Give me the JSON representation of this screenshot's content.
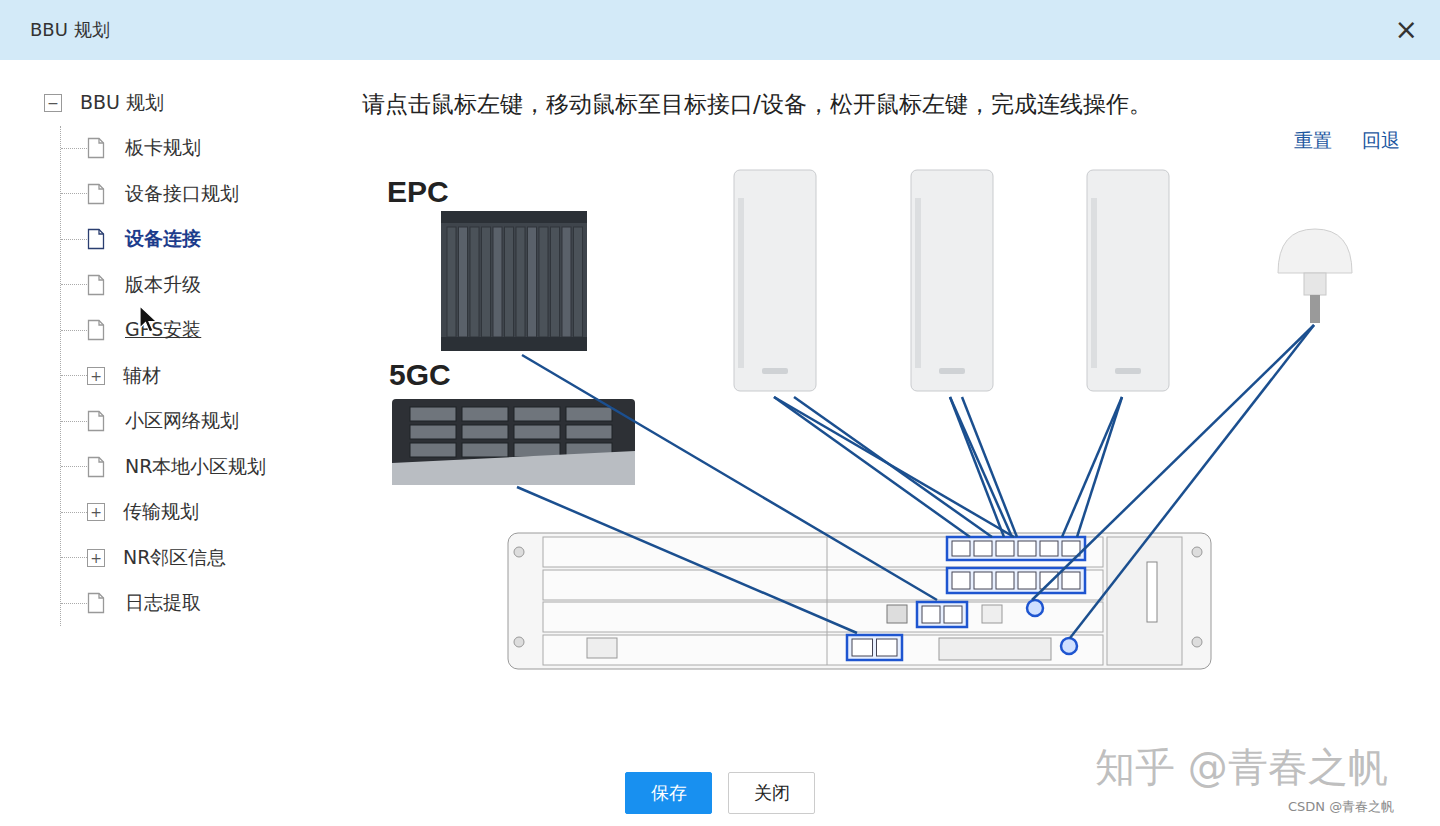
{
  "window": {
    "title": "BBU 规划",
    "close": "×"
  },
  "sidebar": {
    "root": {
      "label": "BBU 规划",
      "toggle": "−",
      "expanded": true,
      "children": [
        {
          "label": "板卡规划",
          "kind": "page",
          "selected": false,
          "hovered": false
        },
        {
          "label": "设备接口规划",
          "kind": "page",
          "selected": false,
          "hovered": false
        },
        {
          "label": "设备连接",
          "kind": "page",
          "selected": true,
          "hovered": false
        },
        {
          "label": "版本升级",
          "kind": "page",
          "selected": false,
          "hovered": false
        },
        {
          "label": "GPS安装",
          "kind": "page",
          "selected": false,
          "hovered": true
        },
        {
          "label": "辅材",
          "kind": "folder",
          "toggle": "+",
          "expanded": false,
          "selected": false,
          "hovered": false
        },
        {
          "label": "小区网络规划",
          "kind": "page",
          "selected": false,
          "hovered": false
        },
        {
          "label": "NR本地小区规划",
          "kind": "page",
          "selected": false,
          "hovered": false
        },
        {
          "label": "传输规划",
          "kind": "folder",
          "toggle": "+",
          "expanded": false,
          "selected": false,
          "hovered": false
        },
        {
          "label": "NR邻区信息",
          "kind": "folder",
          "toggle": "+",
          "expanded": false,
          "selected": false,
          "hovered": false
        },
        {
          "label": "日志提取",
          "kind": "page",
          "selected": false,
          "hovered": false
        }
      ]
    }
  },
  "instruction": "请点击鼠标左键，移动鼠标至目标接口/设备，松开鼠标左键，完成连线操作。",
  "actions": [
    "重置",
    "回退"
  ],
  "diagram": {
    "labels": {
      "epc": "EPC",
      "fivegc": "5GC"
    },
    "links": [
      {
        "connected": true
      },
      {
        "connected": true
      },
      {
        "connected": true
      },
      {
        "connected": true
      },
      {
        "connected": true
      },
      {
        "connected": true
      },
      {
        "connected": true
      },
      {
        "connected": true
      },
      {
        "connected": true
      },
      {
        "connected": true
      },
      {
        "connected": true
      },
      {
        "connected": true
      }
    ]
  },
  "buttons": [
    {
      "label": "保存",
      "primary": true
    },
    {
      "label": "关闭",
      "primary": false
    }
  ],
  "watermarks": [
    "知乎 @青春之帆",
    "CSDN @青春之帆"
  ]
}
